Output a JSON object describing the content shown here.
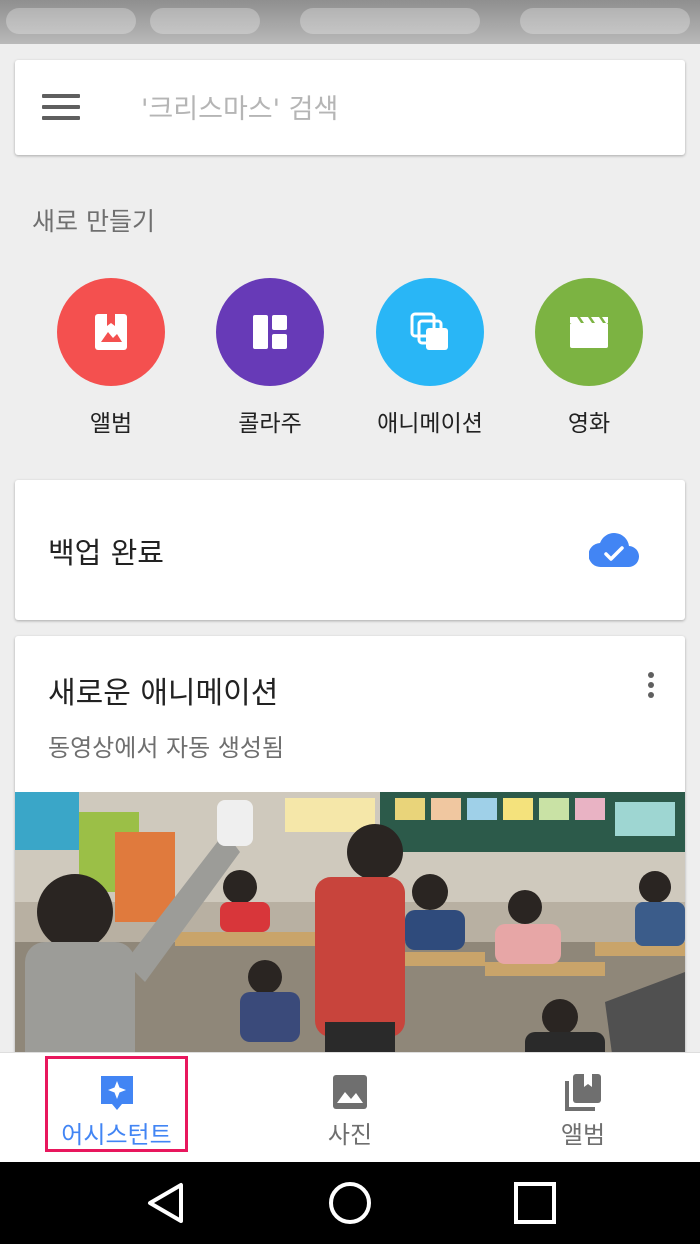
{
  "search": {
    "placeholder": "'크리스마스' 검색"
  },
  "create_new": {
    "heading": "새로 만들기",
    "items": [
      {
        "label": "앨범",
        "icon": "photo-album-icon",
        "color": "#f4504f"
      },
      {
        "label": "콜라주",
        "icon": "collage-icon",
        "color": "#673ab7"
      },
      {
        "label": "애니메이션",
        "icon": "animation-icon",
        "color": "#29b6f6"
      },
      {
        "label": "영화",
        "icon": "movie-clapper-icon",
        "color": "#7cb342"
      }
    ]
  },
  "backup_card": {
    "status": "백업 완료",
    "icon": "cloud-done-icon",
    "icon_color": "#4285f4"
  },
  "animation_card": {
    "title": "새로운 애니메이션",
    "subtitle": "동영상에서 자동 생성됨",
    "menu_icon": "more-vert-icon"
  },
  "bottom_nav": {
    "items": [
      {
        "label": "어시스턴트",
        "icon": "assistant-icon",
        "active": true
      },
      {
        "label": "사진",
        "icon": "photo-icon",
        "active": false
      },
      {
        "label": "앨범",
        "icon": "photo-library-icon",
        "active": false
      }
    ],
    "active_color": "#4285f4",
    "highlight_color": "#e8175d"
  },
  "system_nav": {
    "icons": [
      "back-icon",
      "home-icon",
      "recents-icon"
    ]
  }
}
